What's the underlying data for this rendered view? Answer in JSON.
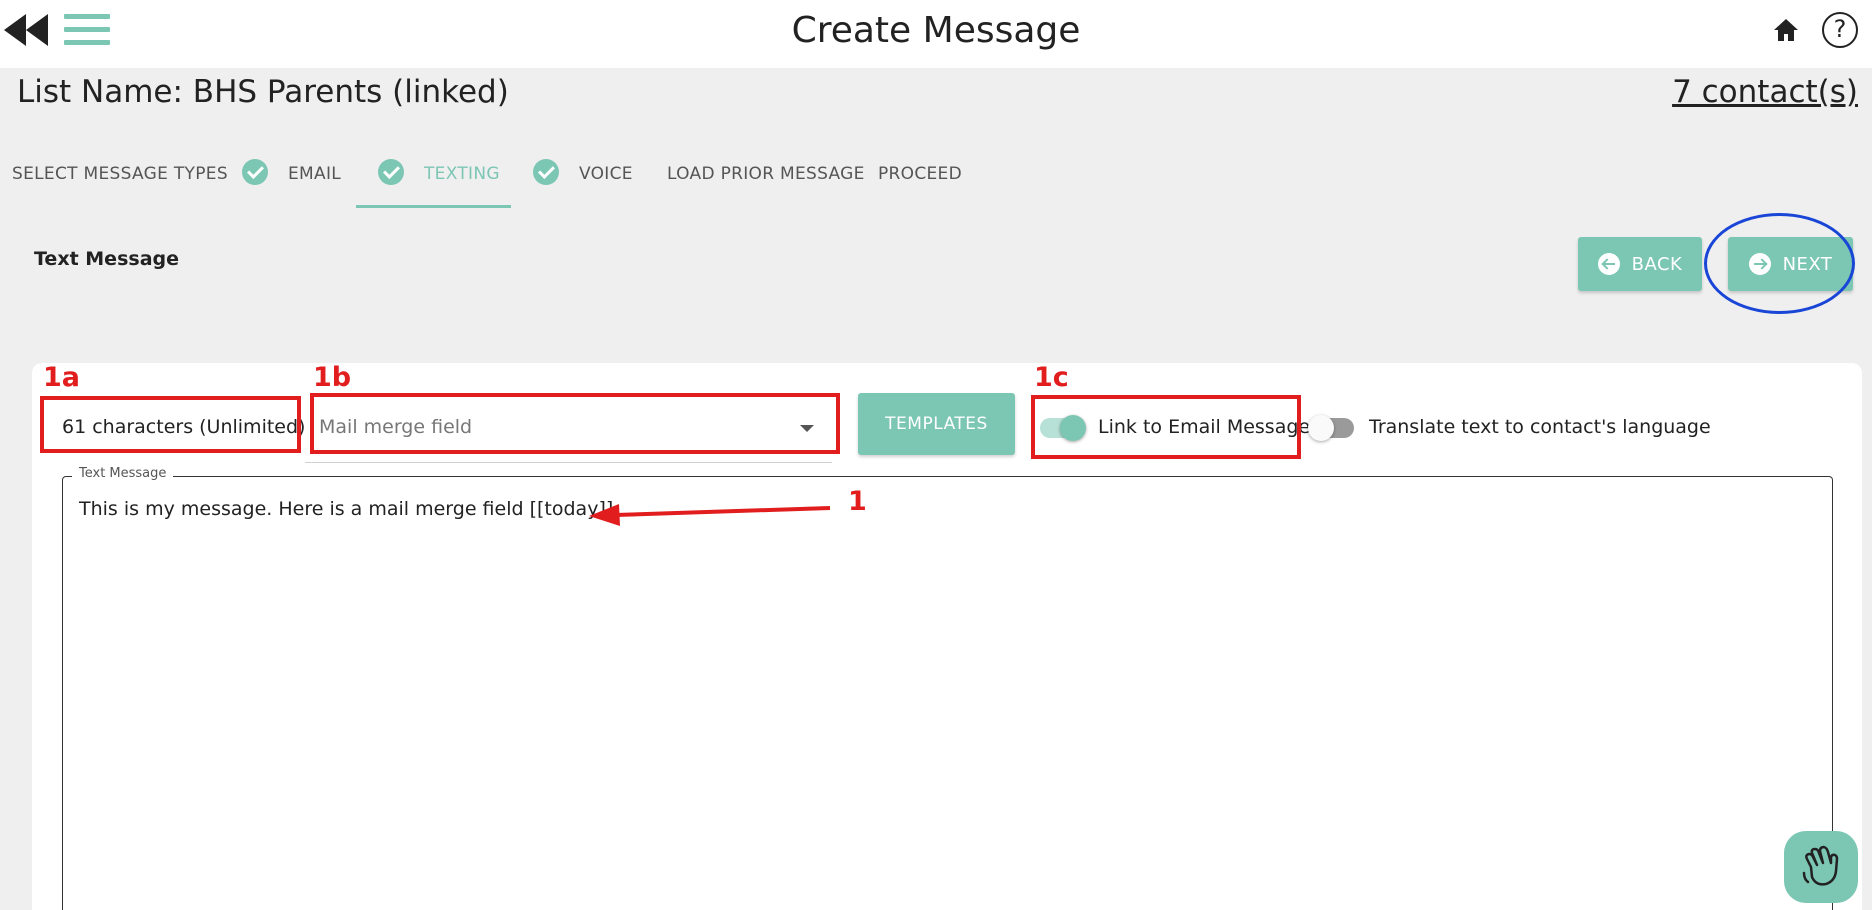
{
  "header": {
    "title": "Create Message",
    "help_label": "?"
  },
  "list": {
    "name": "List Name: BHS Parents (linked)",
    "contacts": "7 contact(s)"
  },
  "tabs": [
    {
      "label": "SELECT MESSAGE TYPES",
      "checked": false,
      "active": false
    },
    {
      "label": "EMAIL",
      "checked": true,
      "active": false
    },
    {
      "label": "TEXTING",
      "checked": true,
      "active": true
    },
    {
      "label": "VOICE",
      "checked": true,
      "active": false
    },
    {
      "label": "LOAD PRIOR MESSAGE",
      "checked": false,
      "active": false
    },
    {
      "label": "PROCEED",
      "checked": false,
      "active": false
    }
  ],
  "section": {
    "title": "Text Message"
  },
  "nav": {
    "back_label": "BACK",
    "next_label": "NEXT"
  },
  "composer": {
    "char_count": "61 characters (Unlimited)",
    "merge_placeholder": "Mail merge field",
    "templates_label": "TEMPLATES",
    "link_email_label": "Link to Email Message",
    "link_email_on": true,
    "translate_label": "Translate text to contact's language",
    "translate_on": false,
    "textarea_label": "Text Message",
    "message": "This is my message. Here is a mail merge field [[today]]."
  },
  "annotations": {
    "a": "1a",
    "b": "1b",
    "c": "1c",
    "arrow": "1"
  },
  "icons": {
    "rewind": "rewind-icon",
    "menu": "hamburger-menu-icon",
    "home": "home-icon",
    "help": "help-icon",
    "check": "check-circle-icon",
    "wave": "waving-hand-icon"
  },
  "colors": {
    "accent": "#7cc6b4",
    "annotation_red": "#e11d1d",
    "highlight_blue": "#1946d6"
  }
}
